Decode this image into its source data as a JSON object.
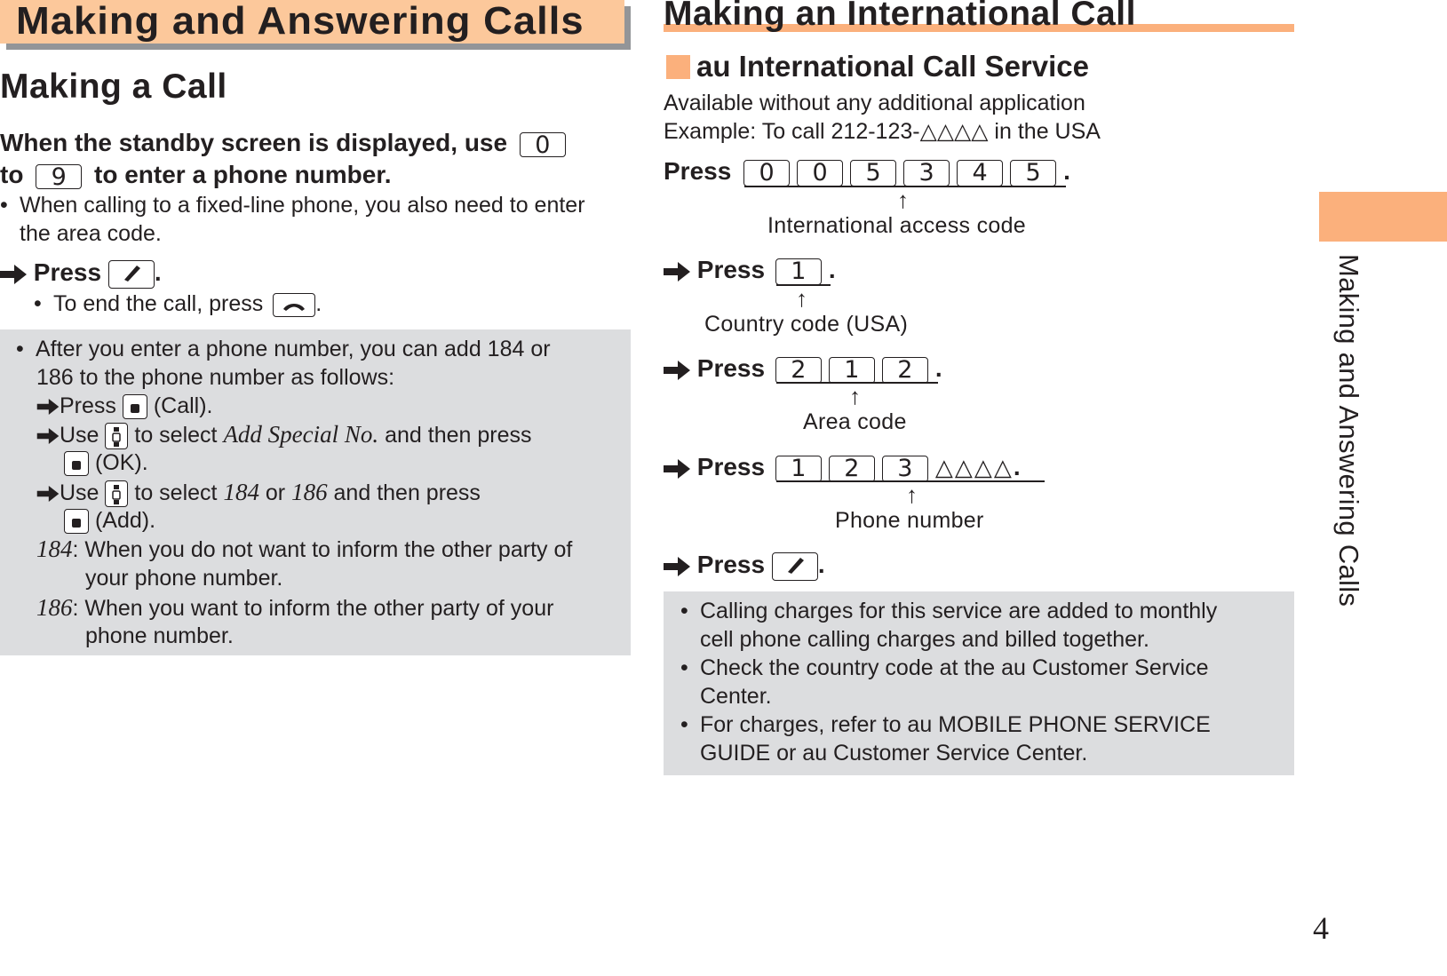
{
  "chapter": {
    "title": "Making and Answering Calls"
  },
  "making_call": {
    "title": "Making a Call",
    "lead_part1": "When the standby screen is displayed, use",
    "lead_key_from": "0",
    "lead_part2": "to",
    "lead_key_to": "9",
    "lead_part3": "to enter a phone number.",
    "bullet1_line1": "When calling to a fixed-line phone, you also need to enter",
    "bullet1_line2": "the area code.",
    "press_label": "Press",
    "end_call_text": "To end the call, press",
    "note": {
      "line1": "After you enter a phone number, you can add 184 or",
      "line2": "186 to the phone number as follows:",
      "step1_press": "Press",
      "step1_after": "(Call).",
      "step2_use": "Use",
      "step2_to_select": "to select",
      "step2_item": "Add Special No.",
      "step2_then": "and then press",
      "step2_after": "(OK).",
      "step3_use": "Use",
      "step3_to_select": "to select",
      "step3_item1": "184",
      "step3_or": "or",
      "step3_item2": "186",
      "step3_then": "and then press",
      "step3_after": "(Add).",
      "def184_key": "184",
      "def184_line1": ": When you do not want to inform the other party of",
      "def184_line2": "your phone number.",
      "def186_key": "186",
      "def186_line1": ": When you want to inform the other party of your",
      "def186_line2": "phone number."
    }
  },
  "international": {
    "title": "Making an International Call",
    "subtitle": "au International Call Service",
    "desc1": "Available without any additional application",
    "desc2": "Example: To call 212-123-△△△△ in the USA",
    "press_label": "Press",
    "step1_keys": [
      "0",
      "0",
      "5",
      "3",
      "4",
      "5"
    ],
    "step1_caption": "International access code",
    "step2_keys": [
      "1"
    ],
    "step2_caption": "Country code (USA)",
    "step3_keys": [
      "2",
      "1",
      "2"
    ],
    "step3_caption": "Area code",
    "step4_keys": [
      "1",
      "2",
      "3"
    ],
    "step4_placeholder": "△△△△",
    "step4_caption": "Phone number",
    "notes": [
      {
        "line1": "Calling charges for this service are added to monthly",
        "line2": "cell phone calling charges and billed together."
      },
      {
        "line1": "Check the country code at the au Customer Service",
        "line2": "Center."
      },
      {
        "line1": "For charges, refer to au MOBILE PHONE SERVICE",
        "line2": "GUIDE or au Customer Service Center."
      }
    ]
  },
  "side_tab": {
    "label": "Making and Answering Calls"
  },
  "page_number": "4",
  "colors": {
    "accent": "#fbb07c",
    "chapter_bar": "#fcc89b",
    "shadow": "#939598",
    "note_bg": "#dcdddf",
    "text": "#231f20"
  }
}
